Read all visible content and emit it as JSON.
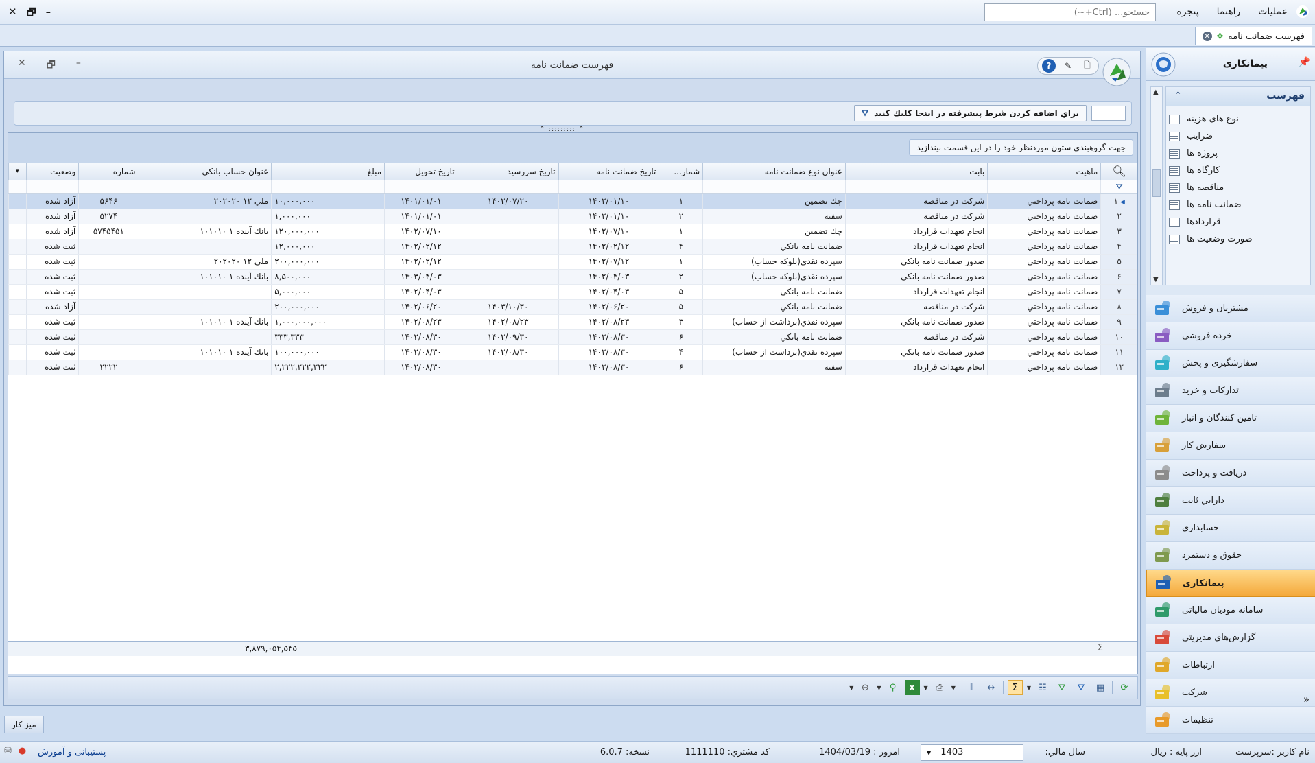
{
  "topbar": {
    "menu": [
      "عملیات",
      "راهنما",
      "پنجره"
    ],
    "search_placeholder": "جستجو... (Ctrl+~)"
  },
  "doc_tab": {
    "label": "فهرست ضمانت نامه"
  },
  "nav": {
    "header_title": "پیمانکاری",
    "list_title": "فهرست",
    "list_items": [
      "نوع های هزینه",
      "ضرایب",
      "پروژه ها",
      "کارگاه ها",
      "مناقصه ها",
      "ضمانت نامه ها",
      "قراردادها",
      "صورت وضعیت ها"
    ],
    "modules": [
      {
        "label": "مشتریان و فروش",
        "icon": "customers-sales-icon",
        "color": "#3a8fd8"
      },
      {
        "label": "خرده فروشی",
        "icon": "retail-icon",
        "color": "#8a5cc2"
      },
      {
        "label": "سفارشگیری و پخش",
        "icon": "order-distribution-icon",
        "color": "#2fb0c9"
      },
      {
        "label": "تدارکات و خرید",
        "icon": "procurement-icon",
        "color": "#6d7d8c"
      },
      {
        "label": "تامین کنندگان و انبار",
        "icon": "suppliers-warehouse-icon",
        "color": "#6fb43a"
      },
      {
        "label": "سفارش کار",
        "icon": "work-order-icon",
        "color": "#d8a03a"
      },
      {
        "label": "دریافت و پرداخت",
        "icon": "receipt-payment-icon",
        "color": "#8c8c8c"
      },
      {
        "label": "دارايي ثابت",
        "icon": "fixed-assets-icon",
        "color": "#4f7f3f"
      },
      {
        "label": "حسابداري",
        "icon": "accounting-icon",
        "color": "#c9b43a"
      },
      {
        "label": "حقوق و دستمزد",
        "icon": "payroll-icon",
        "color": "#7f9a4f"
      },
      {
        "label": "پیمانکاری",
        "icon": "contracting-icon",
        "color": "#1f5fb3",
        "active": true
      },
      {
        "label": "سامانه مودیان مالیاتی",
        "icon": "tax-system-icon",
        "color": "#2f9a6a"
      },
      {
        "label": "گزارش‌های مدیریتی",
        "icon": "management-reports-icon",
        "color": "#d84a3a"
      },
      {
        "label": "ارتباطات",
        "icon": "communications-icon",
        "color": "#e0a82a"
      },
      {
        "label": "شرکت",
        "icon": "company-icon",
        "color": "#e8c02a"
      },
      {
        "label": "تنظیمات",
        "icon": "settings-icon",
        "color": "#e89a2a"
      }
    ]
  },
  "inner": {
    "title": "فهرست ضمانت نامه",
    "filter_button": "براي اضافه كردن شرط پيشرفته در اينجا كليك كنيد",
    "group_hint": "جهت گروهبندی ستون موردنظر خود را در این قسمت بیندازید"
  },
  "grid": {
    "columns": [
      "ماهیت",
      "بابت",
      "عنوان نوع ضمانت نامه",
      "شمار...",
      "تاریخ ضمانت نامه",
      "تاریخ سررسید",
      "تاریخ تحویل",
      "مبلغ",
      "عنوان حساب بانکی",
      "شماره",
      "وضعیت"
    ],
    "rows": [
      {
        "n": "۱",
        "nature": "ضمانت نامه پرداختي",
        "for": "شرکت در مناقصه",
        "type": "چك تضمين",
        "count": "۱",
        "date": "۱۴۰۲/۰۱/۱۰",
        "due": "۱۴۰۲/۰۷/۲۰",
        "deliver": "۱۴۰۱/۰۱/۰۱",
        "amount": "۱۰,۰۰۰,۰۰۰",
        "bank": "ملي ۱۲ ۲۰۲۰۲۰",
        "no": "۵۶۴۶",
        "status": "آزاد شده"
      },
      {
        "n": "۲",
        "nature": "ضمانت نامه پرداختي",
        "for": "شرکت در مناقصه",
        "type": "سفته",
        "count": "۲",
        "date": "۱۴۰۲/۰۱/۱۰",
        "due": "",
        "deliver": "۱۴۰۱/۰۱/۰۱",
        "amount": "۱,۰۰۰,۰۰۰",
        "bank": "",
        "no": "۵۲۷۴",
        "status": "آزاد شده"
      },
      {
        "n": "۳",
        "nature": "ضمانت نامه پرداختي",
        "for": "انجام تعهدات قرارداد",
        "type": "چك تضمين",
        "count": "۱",
        "date": "۱۴۰۲/۰۷/۱۰",
        "due": "",
        "deliver": "۱۴۰۲/۰۷/۱۰",
        "amount": "۱۲۰,۰۰۰,۰۰۰",
        "bank": "بانك آينده ۱ ۱۰۱۰۱۰",
        "no": "۵۷۴۵۴۵۱",
        "status": "آزاد شده"
      },
      {
        "n": "۴",
        "nature": "ضمانت نامه پرداختي",
        "for": "انجام تعهدات قرارداد",
        "type": "ضمانت نامه بانكي",
        "count": "۴",
        "date": "۱۴۰۲/۰۲/۱۲",
        "due": "",
        "deliver": "۱۴۰۲/۰۲/۱۲",
        "amount": "۱۲,۰۰۰,۰۰۰",
        "bank": "",
        "no": "",
        "status": "ثبت شده"
      },
      {
        "n": "۵",
        "nature": "ضمانت نامه پرداختي",
        "for": "صدور ضمانت نامه بانكي",
        "type": "سپرده نقدي(بلوكه حساب)",
        "count": "۱",
        "date": "۱۴۰۲/۰۷/۱۲",
        "due": "",
        "deliver": "۱۴۰۲/۰۲/۱۲",
        "amount": "۲۰۰,۰۰۰,۰۰۰",
        "bank": "ملي ۱۲ ۲۰۲۰۲۰",
        "no": "",
        "status": "ثبت شده"
      },
      {
        "n": "۶",
        "nature": "ضمانت نامه پرداختي",
        "for": "صدور ضمانت نامه بانكي",
        "type": "سپرده نقدي(بلوكه حساب)",
        "count": "۲",
        "date": "۱۴۰۲/۰۴/۰۳",
        "due": "",
        "deliver": "۱۴۰۳/۰۴/۰۳",
        "amount": "۸,۵۰۰,۰۰۰",
        "bank": "بانك آينده ۱ ۱۰۱۰۱۰",
        "no": "",
        "status": "ثبت شده"
      },
      {
        "n": "۷",
        "nature": "ضمانت نامه پرداختي",
        "for": "انجام تعهدات قرارداد",
        "type": "ضمانت نامه بانكي",
        "count": "۵",
        "date": "۱۴۰۲/۰۴/۰۳",
        "due": "",
        "deliver": "۱۴۰۲/۰۴/۰۳",
        "amount": "۵,۰۰۰,۰۰۰",
        "bank": "",
        "no": "",
        "status": "ثبت شده"
      },
      {
        "n": "۸",
        "nature": "ضمانت نامه پرداختي",
        "for": "شرکت در مناقصه",
        "type": "ضمانت نامه بانكي",
        "count": "۵",
        "date": "۱۴۰۲/۰۶/۲۰",
        "due": "۱۴۰۳/۱۰/۳۰",
        "deliver": "۱۴۰۲/۰۶/۲۰",
        "amount": "۲۰۰,۰۰۰,۰۰۰",
        "bank": "",
        "no": "",
        "status": "آزاد شده"
      },
      {
        "n": "۹",
        "nature": "ضمانت نامه پرداختي",
        "for": "صدور ضمانت نامه بانكي",
        "type": "سپرده نقدي(برداشت از حساب)",
        "count": "۳",
        "date": "۱۴۰۲/۰۸/۲۳",
        "due": "۱۴۰۲/۰۸/۲۳",
        "deliver": "۱۴۰۲/۰۸/۲۳",
        "amount": "۱,۰۰۰,۰۰۰,۰۰۰",
        "bank": "بانك آينده ۱ ۱۰۱۰۱۰",
        "no": "",
        "status": "ثبت شده"
      },
      {
        "n": "۱۰",
        "nature": "ضمانت نامه پرداختي",
        "for": "شرکت در مناقصه",
        "type": "ضمانت نامه بانكي",
        "count": "۶",
        "date": "۱۴۰۲/۰۸/۳۰",
        "due": "۱۴۰۲/۰۹/۳۰",
        "deliver": "۱۴۰۲/۰۸/۳۰",
        "amount": "۳۳۳,۳۳۳",
        "bank": "",
        "no": "",
        "status": "ثبت شده"
      },
      {
        "n": "۱۱",
        "nature": "ضمانت نامه پرداختي",
        "for": "صدور ضمانت نامه بانكي",
        "type": "سپرده نقدي(برداشت از حساب)",
        "count": "۴",
        "date": "۱۴۰۲/۰۸/۳۰",
        "due": "۱۴۰۲/۰۸/۳۰",
        "deliver": "۱۴۰۲/۰۸/۳۰",
        "amount": "۱۰۰,۰۰۰,۰۰۰",
        "bank": "بانك آينده ۱ ۱۰۱۰۱۰",
        "no": "",
        "status": "ثبت شده"
      },
      {
        "n": "۱۲",
        "nature": "ضمانت نامه پرداختي",
        "for": "انجام تعهدات قرارداد",
        "type": "سفته",
        "count": "۶",
        "date": "۱۴۰۲/۰۸/۳۰",
        "due": "",
        "deliver": "۱۴۰۲/۰۸/۳۰",
        "amount": "۲,۲۲۲,۲۲۲,۲۲۲",
        "bank": "",
        "no": "۲۲۲۲",
        "status": "ثبت شده"
      }
    ],
    "total_amount": "۳,۸۷۹,۰۵۴,۵۴۵"
  },
  "desk": {
    "label": "ميز کار"
  },
  "status": {
    "user": "نام كاربر :سرپرست",
    "currency": "ارز پايه :   ريال",
    "fiscal_label": "سال مالي:",
    "fiscal_year": "1403",
    "today": "امروز :   1404/03/19",
    "customer": "كد مشتري:   1111110",
    "version": "نسخه:   6.0.7",
    "support": "پشتیبانی و آموزش"
  }
}
